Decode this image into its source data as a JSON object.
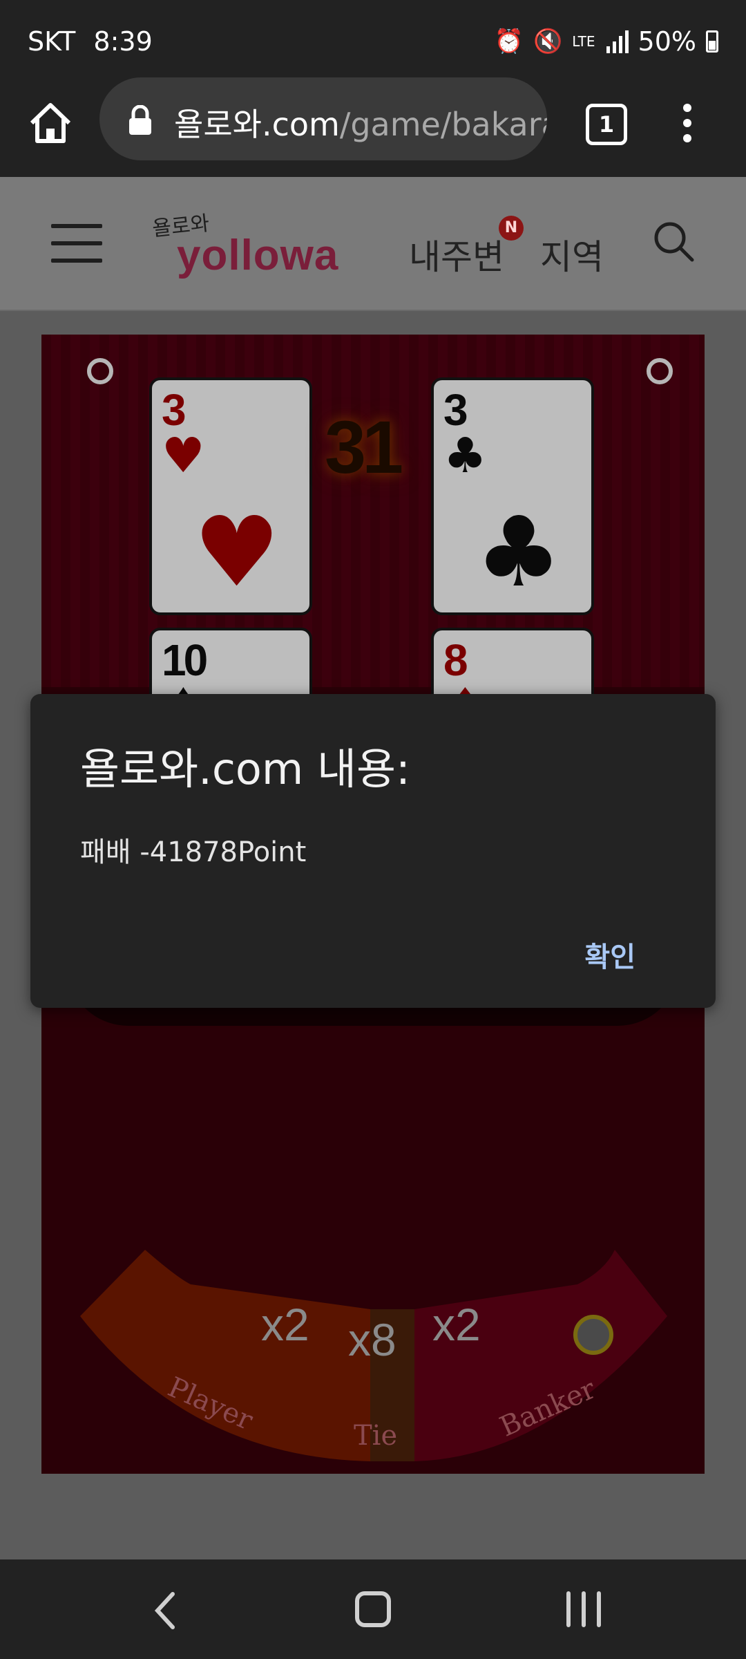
{
  "status_bar": {
    "carrier": "SKT",
    "time": "8:39",
    "network": "LTE",
    "battery": "50%",
    "icons": [
      "alarm-icon",
      "mute-icon",
      "lte-icon",
      "signal-icon",
      "battery-icon"
    ]
  },
  "browser": {
    "url_host": "욜로와.com",
    "url_path": "/game/bakara",
    "tab_count": "1",
    "icons": [
      "home-icon",
      "lock-icon",
      "tabs-icon",
      "menu-icon"
    ]
  },
  "site_header": {
    "logo_small": "욜로와",
    "logo": "yollowa",
    "nav_mine": "내주변",
    "nav_badge": "N",
    "nav_area": "지역"
  },
  "game": {
    "score": "31",
    "cards": [
      {
        "rank": "3",
        "suit": "♥",
        "color": "red"
      },
      {
        "rank": "3",
        "suit": "♣",
        "color": "black"
      },
      {
        "rank": "10",
        "suit": "♠",
        "color": "black"
      },
      {
        "rank": "8",
        "suit": "♦",
        "color": "red"
      }
    ],
    "bets": {
      "player_label": "Player",
      "player_mult": "x2",
      "tie_label": "Tie",
      "tie_mult": "x8",
      "banker_label": "Banker",
      "banker_mult": "x2"
    }
  },
  "dialog": {
    "title": "욜로와.com 내용:",
    "message": "패배 -41878Point",
    "ok_label": "확인"
  },
  "colors": {
    "dialog_bg": "#232323",
    "ok_text": "#a9c8f5",
    "board_bg": "#2a0007",
    "badge": "#8c1414"
  }
}
